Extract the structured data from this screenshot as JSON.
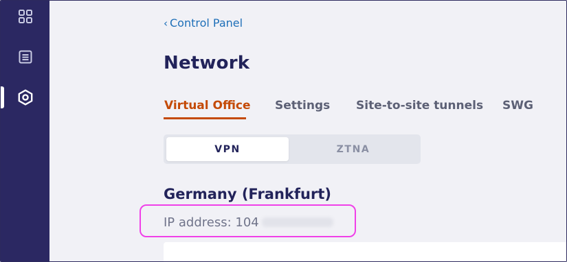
{
  "sidebar": {
    "icons": [
      {
        "name": "dashboard-icon",
        "active": false
      },
      {
        "name": "list-icon",
        "active": false
      },
      {
        "name": "network-icon",
        "active": true
      }
    ]
  },
  "breadcrumb": {
    "chevron": "‹",
    "label": "Control Panel"
  },
  "page": {
    "title": "Network"
  },
  "tabs": [
    {
      "label": "Virtual Office",
      "active": true
    },
    {
      "label": "Settings",
      "active": false
    },
    {
      "label": "Site-to-site tunnels",
      "active": false
    },
    {
      "label": "SWG",
      "active": false
    }
  ],
  "segmented": {
    "options": [
      "VPN",
      "ZTNA"
    ],
    "selected": "VPN"
  },
  "location": {
    "name": "Germany (Frankfurt)",
    "ip_label": "IP address: 104"
  },
  "colors": {
    "sidebar_bg": "#2b2862",
    "accent": "#c44a06",
    "link": "#1e6fb8",
    "highlight": "#f040e8"
  }
}
